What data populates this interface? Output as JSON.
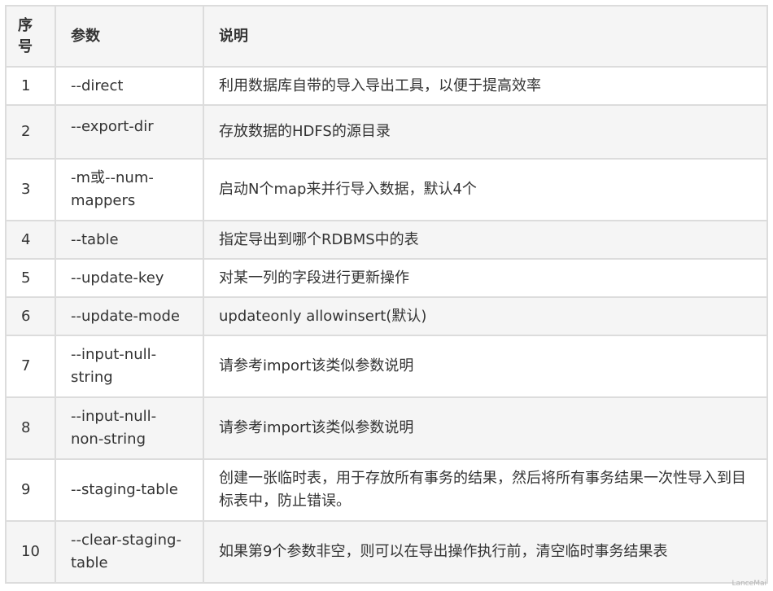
{
  "table": {
    "headers": [
      "序号",
      "参数",
      "说明"
    ],
    "rows": [
      {
        "num": "1",
        "param": "--direct",
        "desc": "利用数据库自带的导入导出工具，以便于提高效率"
      },
      {
        "num": "2",
        "param": "--export-dir",
        "desc": "存放数据的HDFS的源目录"
      },
      {
        "num": "3",
        "param": "-m或--num-mappers",
        "desc": "启动N个map来并行导入数据，默认4个"
      },
      {
        "num": "4",
        "param": "--table",
        "desc": "指定导出到哪个RDBMS中的表"
      },
      {
        "num": "5",
        "param": "--update-key",
        "desc": "对某一列的字段进行更新操作"
      },
      {
        "num": "6",
        "param": "--update-mode",
        "desc": "updateonly allowinsert(默认)"
      },
      {
        "num": "7",
        "param": "--input-null-string",
        "desc": "请参考import该类似参数说明"
      },
      {
        "num": "8",
        "param": "--input-null-non-string",
        "desc": "请参考import该类似参数说明"
      },
      {
        "num": "9",
        "param": "--staging-table",
        "desc": "创建一张临时表，用于存放所有事务的结果，然后将所有事务结果一次性导入到目标表中，防止错误。"
      },
      {
        "num": "10",
        "param": "--clear-staging-table",
        "desc": "如果第9个参数非空，则可以在导出操作执行前，清空临时事务结果表"
      }
    ]
  },
  "watermark": "LanceMai"
}
